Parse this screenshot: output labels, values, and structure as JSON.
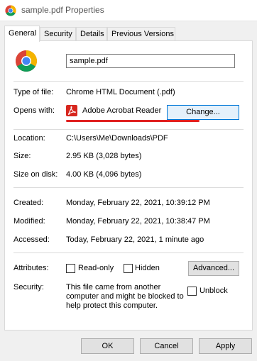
{
  "window": {
    "title": "sample.pdf Properties",
    "icon": "chrome-icon"
  },
  "tabs": [
    "General",
    "Security",
    "Details",
    "Previous Versions"
  ],
  "active_tab": "General",
  "general": {
    "file_name": "sample.pdf",
    "type_of_file_label": "Type of file:",
    "type_of_file": "Chrome HTML Document (.pdf)",
    "opens_with_label": "Opens with:",
    "opens_with": "Adobe Acrobat Reader",
    "change_label": "Change...",
    "location_label": "Location:",
    "location": "C:\\Users\\Me\\Downloads\\PDF",
    "size_label": "Size:",
    "size": "2.95 KB (3,028 bytes)",
    "size_on_disk_label": "Size on disk:",
    "size_on_disk": "4.00 KB (4,096 bytes)",
    "created_label": "Created:",
    "created": "Monday, February 22, 2021, 10:39:12 PM",
    "modified_label": "Modified:",
    "modified": "Monday, February 22, 2021, 10:38:47 PM",
    "accessed_label": "Accessed:",
    "accessed": "Today, February 22, 2021, 1 minute ago",
    "attributes_label": "Attributes:",
    "readonly_label": "Read-only",
    "readonly_checked": false,
    "hidden_label": "Hidden",
    "hidden_checked": false,
    "advanced_label": "Advanced...",
    "security_label": "Security:",
    "security_text": "This file came from another computer and might be blocked to help protect this computer.",
    "unblock_label": "Unblock",
    "unblock_checked": false
  },
  "footer": {
    "ok_label": "OK",
    "cancel_label": "Cancel",
    "apply_label": "Apply"
  },
  "colors": {
    "focus_blue": "#0078d7",
    "annotation_red": "#e02020",
    "pdf_red": "#d7261e"
  }
}
